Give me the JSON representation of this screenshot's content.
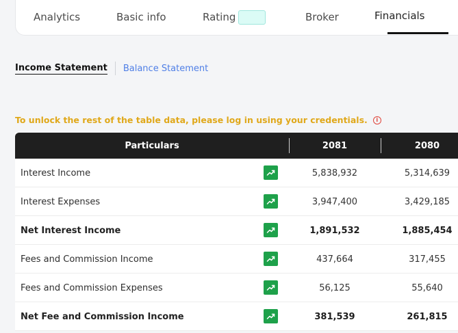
{
  "top_tabs": [
    {
      "label": "Analytics"
    },
    {
      "label": "Basic info"
    },
    {
      "label": "Rating"
    },
    {
      "label": "Broker"
    },
    {
      "label": "Financials"
    }
  ],
  "active_tab": "Financials",
  "sub_tabs": {
    "active": "Income Statement",
    "other": "Balance Statement"
  },
  "notice": "To unlock the rest of the table data, please log in using your credentials.",
  "table": {
    "headers": [
      "Particulars",
      "2081",
      "2080"
    ],
    "rows": [
      {
        "label": "Interest Income",
        "v2081": "5,838,932",
        "v2080": "5,314,639",
        "bold": false
      },
      {
        "label": "Interest Expenses",
        "v2081": "3,947,400",
        "v2080": "3,429,185",
        "bold": false
      },
      {
        "label": "Net Interest Income",
        "v2081": "1,891,532",
        "v2080": "1,885,454",
        "bold": true
      },
      {
        "label": "Fees and Commission Income",
        "v2081": "437,664",
        "v2080": "317,455",
        "bold": false
      },
      {
        "label": "Fees and Commission Expenses",
        "v2081": "56,125",
        "v2080": "55,640",
        "bold": false
      },
      {
        "label": "Net Fee and Commission Income",
        "v2081": "381,539",
        "v2080": "261,815",
        "bold": true
      }
    ]
  },
  "colors": {
    "notice": "#e0a81a",
    "chart_button": "#1ea14a",
    "header_bg": "#1f1f1f",
    "link": "#4f7fe6"
  }
}
